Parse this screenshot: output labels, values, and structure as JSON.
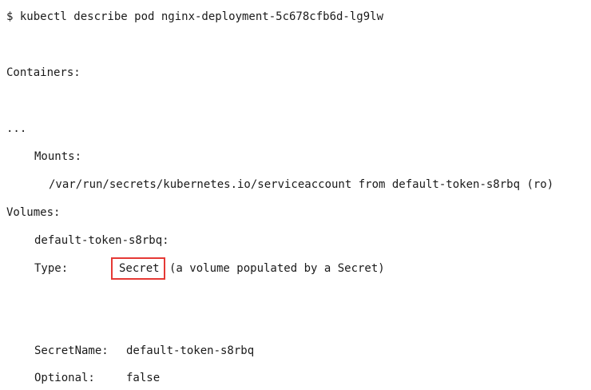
{
  "command": "$ kubectl describe pod nginx-deployment-5c678cfb6d-lg9lw",
  "containers_label": "Containers:",
  "ellipsis": "...",
  "mounts_label": "Mounts:",
  "mount_path": "/var/run/secrets/kubernetes.io/serviceaccount from default-token-s8rbq (ro)",
  "volumes_label": "Volumes:",
  "volume_name": "default-token-s8rbq:",
  "type": {
    "label": "Type:",
    "value": "Secret",
    "description": "(a volume populated by a Secret)"
  },
  "secret_name": {
    "label": "SecretName:",
    "value": "default-token-s8rbq"
  },
  "optional": {
    "label": "Optional:",
    "value": "false"
  },
  "colors": {
    "highlight_border": "#e53935",
    "text": "#1a1a1a",
    "background": "#ffffff"
  }
}
